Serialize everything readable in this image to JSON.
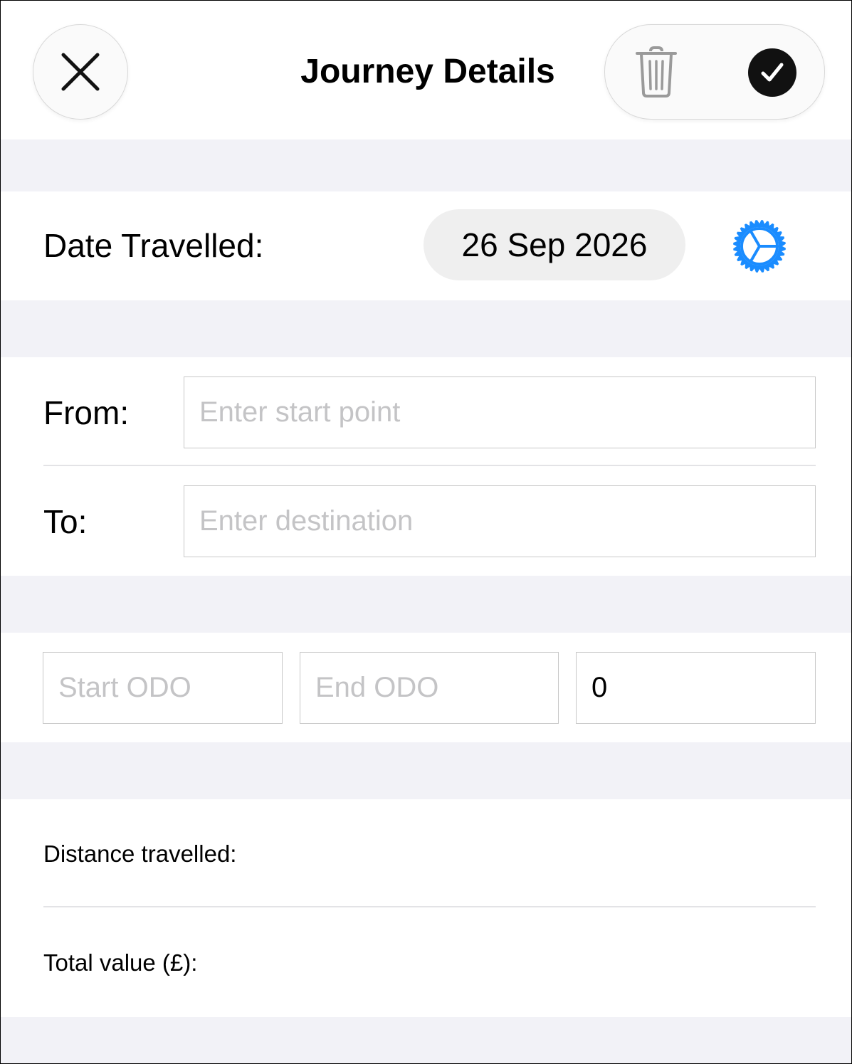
{
  "header": {
    "title": "Journey Details",
    "icons": {
      "close": "close-icon",
      "delete": "trash-icon",
      "confirm": "checkmark-icon"
    }
  },
  "date_section": {
    "label": "Date Travelled:",
    "value": "26 Sep 2026",
    "settings_icon": "gear-icon",
    "accent_color": "#1a8cff"
  },
  "route_section": {
    "from_label": "From:",
    "from_placeholder": "Enter start point",
    "from_value": "",
    "to_label": "To:",
    "to_placeholder": "Enter destination",
    "to_value": ""
  },
  "odometer_section": {
    "start_placeholder": "Start ODO",
    "start_value": "",
    "end_placeholder": "End ODO",
    "end_value": "",
    "distance_value": "0"
  },
  "totals_section": {
    "distance_label": "Distance travelled:",
    "value_label": "Total value (£):"
  }
}
